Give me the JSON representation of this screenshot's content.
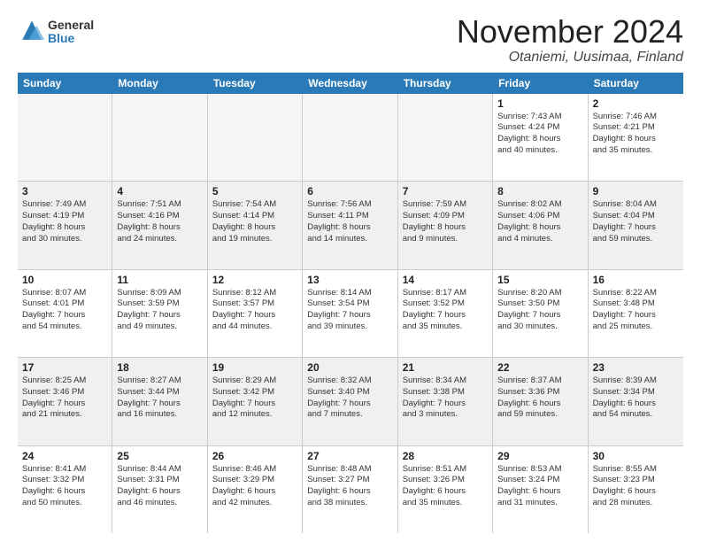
{
  "logo": {
    "general": "General",
    "blue": "Blue"
  },
  "title": "November 2024",
  "location": "Otaniemi, Uusimaa, Finland",
  "weekdays": [
    "Sunday",
    "Monday",
    "Tuesday",
    "Wednesday",
    "Thursday",
    "Friday",
    "Saturday"
  ],
  "rows": [
    [
      {
        "day": "",
        "info": "",
        "empty": true
      },
      {
        "day": "",
        "info": "",
        "empty": true
      },
      {
        "day": "",
        "info": "",
        "empty": true
      },
      {
        "day": "",
        "info": "",
        "empty": true
      },
      {
        "day": "",
        "info": "",
        "empty": true
      },
      {
        "day": "1",
        "info": "Sunrise: 7:43 AM\nSunset: 4:24 PM\nDaylight: 8 hours\nand 40 minutes.",
        "empty": false
      },
      {
        "day": "2",
        "info": "Sunrise: 7:46 AM\nSunset: 4:21 PM\nDaylight: 8 hours\nand 35 minutes.",
        "empty": false
      }
    ],
    [
      {
        "day": "3",
        "info": "Sunrise: 7:49 AM\nSunset: 4:19 PM\nDaylight: 8 hours\nand 30 minutes.",
        "empty": false
      },
      {
        "day": "4",
        "info": "Sunrise: 7:51 AM\nSunset: 4:16 PM\nDaylight: 8 hours\nand 24 minutes.",
        "empty": false
      },
      {
        "day": "5",
        "info": "Sunrise: 7:54 AM\nSunset: 4:14 PM\nDaylight: 8 hours\nand 19 minutes.",
        "empty": false
      },
      {
        "day": "6",
        "info": "Sunrise: 7:56 AM\nSunset: 4:11 PM\nDaylight: 8 hours\nand 14 minutes.",
        "empty": false
      },
      {
        "day": "7",
        "info": "Sunrise: 7:59 AM\nSunset: 4:09 PM\nDaylight: 8 hours\nand 9 minutes.",
        "empty": false
      },
      {
        "day": "8",
        "info": "Sunrise: 8:02 AM\nSunset: 4:06 PM\nDaylight: 8 hours\nand 4 minutes.",
        "empty": false
      },
      {
        "day": "9",
        "info": "Sunrise: 8:04 AM\nSunset: 4:04 PM\nDaylight: 7 hours\nand 59 minutes.",
        "empty": false
      }
    ],
    [
      {
        "day": "10",
        "info": "Sunrise: 8:07 AM\nSunset: 4:01 PM\nDaylight: 7 hours\nand 54 minutes.",
        "empty": false
      },
      {
        "day": "11",
        "info": "Sunrise: 8:09 AM\nSunset: 3:59 PM\nDaylight: 7 hours\nand 49 minutes.",
        "empty": false
      },
      {
        "day": "12",
        "info": "Sunrise: 8:12 AM\nSunset: 3:57 PM\nDaylight: 7 hours\nand 44 minutes.",
        "empty": false
      },
      {
        "day": "13",
        "info": "Sunrise: 8:14 AM\nSunset: 3:54 PM\nDaylight: 7 hours\nand 39 minutes.",
        "empty": false
      },
      {
        "day": "14",
        "info": "Sunrise: 8:17 AM\nSunset: 3:52 PM\nDaylight: 7 hours\nand 35 minutes.",
        "empty": false
      },
      {
        "day": "15",
        "info": "Sunrise: 8:20 AM\nSunset: 3:50 PM\nDaylight: 7 hours\nand 30 minutes.",
        "empty": false
      },
      {
        "day": "16",
        "info": "Sunrise: 8:22 AM\nSunset: 3:48 PM\nDaylight: 7 hours\nand 25 minutes.",
        "empty": false
      }
    ],
    [
      {
        "day": "17",
        "info": "Sunrise: 8:25 AM\nSunset: 3:46 PM\nDaylight: 7 hours\nand 21 minutes.",
        "empty": false
      },
      {
        "day": "18",
        "info": "Sunrise: 8:27 AM\nSunset: 3:44 PM\nDaylight: 7 hours\nand 16 minutes.",
        "empty": false
      },
      {
        "day": "19",
        "info": "Sunrise: 8:29 AM\nSunset: 3:42 PM\nDaylight: 7 hours\nand 12 minutes.",
        "empty": false
      },
      {
        "day": "20",
        "info": "Sunrise: 8:32 AM\nSunset: 3:40 PM\nDaylight: 7 hours\nand 7 minutes.",
        "empty": false
      },
      {
        "day": "21",
        "info": "Sunrise: 8:34 AM\nSunset: 3:38 PM\nDaylight: 7 hours\nand 3 minutes.",
        "empty": false
      },
      {
        "day": "22",
        "info": "Sunrise: 8:37 AM\nSunset: 3:36 PM\nDaylight: 6 hours\nand 59 minutes.",
        "empty": false
      },
      {
        "day": "23",
        "info": "Sunrise: 8:39 AM\nSunset: 3:34 PM\nDaylight: 6 hours\nand 54 minutes.",
        "empty": false
      }
    ],
    [
      {
        "day": "24",
        "info": "Sunrise: 8:41 AM\nSunset: 3:32 PM\nDaylight: 6 hours\nand 50 minutes.",
        "empty": false
      },
      {
        "day": "25",
        "info": "Sunrise: 8:44 AM\nSunset: 3:31 PM\nDaylight: 6 hours\nand 46 minutes.",
        "empty": false
      },
      {
        "day": "26",
        "info": "Sunrise: 8:46 AM\nSunset: 3:29 PM\nDaylight: 6 hours\nand 42 minutes.",
        "empty": false
      },
      {
        "day": "27",
        "info": "Sunrise: 8:48 AM\nSunset: 3:27 PM\nDaylight: 6 hours\nand 38 minutes.",
        "empty": false
      },
      {
        "day": "28",
        "info": "Sunrise: 8:51 AM\nSunset: 3:26 PM\nDaylight: 6 hours\nand 35 minutes.",
        "empty": false
      },
      {
        "day": "29",
        "info": "Sunrise: 8:53 AM\nSunset: 3:24 PM\nDaylight: 6 hours\nand 31 minutes.",
        "empty": false
      },
      {
        "day": "30",
        "info": "Sunrise: 8:55 AM\nSunset: 3:23 PM\nDaylight: 6 hours\nand 28 minutes.",
        "empty": false
      }
    ]
  ]
}
